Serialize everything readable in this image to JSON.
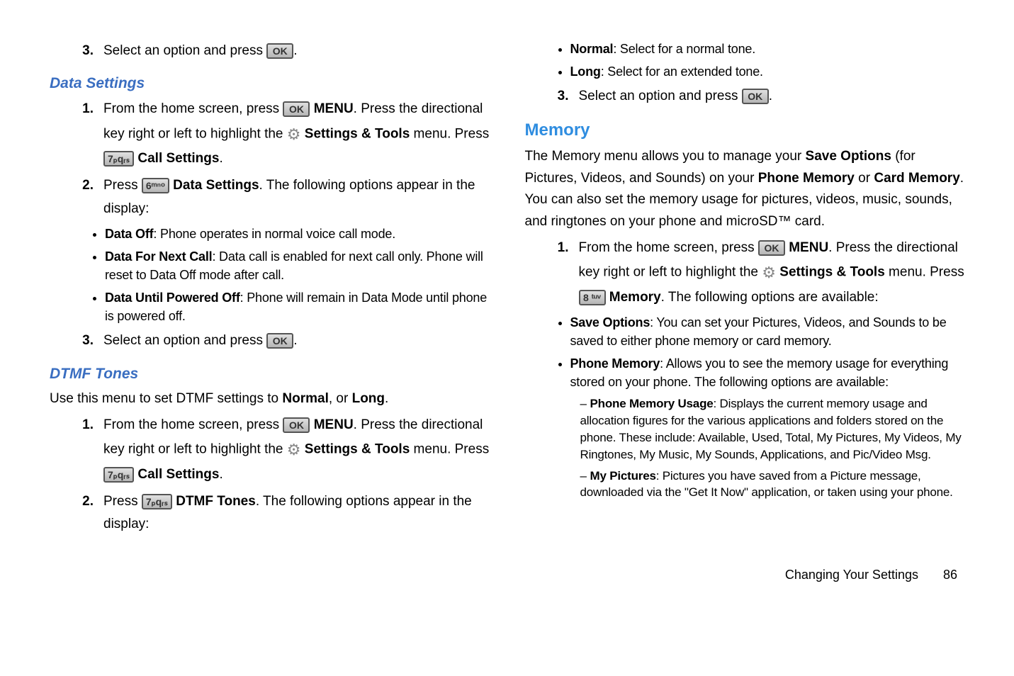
{
  "left": {
    "step3a": {
      "num": "3.",
      "text_a": "Select an option and press ",
      "text_b": "."
    },
    "dataSettings": "Data Settings",
    "ds_step1": {
      "num": "1.",
      "t1": "From the home screen, press ",
      "menu": "MENU",
      "t2": ". Press the directional key right or left to highlight the ",
      "st": "Settings & Tools",
      "t3": " menu. Press ",
      "cs": "Call Settings",
      "t4": "."
    },
    "ds_step2": {
      "num": "2.",
      "t1": "Press ",
      "ds": "Data Settings",
      "t2": ". The following options appear in the display:"
    },
    "ds_bullets": [
      {
        "b": "Data Off",
        "t": ": Phone operates in normal voice call mode."
      },
      {
        "b": "Data For Next Call",
        "t": ": Data call is enabled for next call only. Phone will reset to Data Off mode after call."
      },
      {
        "b": "Data Until Powered Off",
        "t": ": Phone will remain in Data Mode until phone is powered off."
      }
    ],
    "ds_step3": {
      "num": "3.",
      "t1": "Select an option and press ",
      "t2": "."
    },
    "dtmf": "DTMF Tones",
    "dtmf_intro_a": "Use this menu to set DTMF settings to ",
    "dtmf_intro_b": "Normal",
    "dtmf_intro_c": ", or ",
    "dtmf_intro_d": "Long",
    "dtmf_intro_e": ".",
    "dt_step1": {
      "num": "1.",
      "t1": "From the home screen, press ",
      "menu": "MENU",
      "t2": ". Press the directional key right or left to highlight the ",
      "st": "Settings & Tools",
      "t3": " menu. Press ",
      "cs": "Call Settings",
      "t4": "."
    },
    "dt_step2": {
      "num": "2.",
      "t1": "Press ",
      "dt": "DTMF Tones",
      "t2": ". The following options appear in the display:"
    }
  },
  "right": {
    "top_bullets": [
      {
        "b": "Normal",
        "t": ": Select for a normal tone."
      },
      {
        "b": "Long",
        "t": ": Select for an extended tone."
      }
    ],
    "step3": {
      "num": "3.",
      "t1": "Select an option and press ",
      "t2": "."
    },
    "memory": "Memory",
    "mem_intro": {
      "a": "The Memory menu allows you to manage your ",
      "b": "Save Options",
      "c": " (for Pictures, Videos, and Sounds) on your ",
      "d": "Phone Memory",
      "e": " or ",
      "f": "Card Memory",
      "g": ". You can also set the memory usage for pictures, videos, music, sounds, and ringtones on your phone and microSD™ card."
    },
    "mem_step1": {
      "num": "1.",
      "t1": "From the home screen, press ",
      "menu": "MENU",
      "t2": ". Press the directional key right or left to highlight the ",
      "st": "Settings & Tools",
      "t3": " menu. Press ",
      "mem": "Memory",
      "t4": ". The following options are available:"
    },
    "mem_bullets": [
      {
        "b": "Save Options",
        "t": ": You can set your Pictures, Videos, and Sounds to be saved to either phone memory or card memory."
      },
      {
        "b": "Phone Memory",
        "t": ": Allows you to see the memory usage for everything stored on your phone. The following options are available:"
      }
    ],
    "mem_sub": [
      {
        "b": "Phone Memory Usage",
        "t": ": Displays the current memory usage and allocation figures for the various applications and folders stored on the phone. These include: Available, Used, Total, My Pictures, My Videos, My Ringtones, My Music, My Sounds, Applications, and Pic/Video Msg."
      },
      {
        "b": "My Pictures",
        "t": ": Pictures you have saved from a Picture message, downloaded via the \"Get It Now\" application, or taken using your phone."
      }
    ]
  },
  "keys": {
    "ok": "OK",
    "k6": "6ᵐⁿᵒ",
    "k7": "7ₚqᵣₛ",
    "k8": "8 ᵗᵘᵛ"
  },
  "footer": {
    "title": "Changing Your Settings",
    "page": "86"
  }
}
